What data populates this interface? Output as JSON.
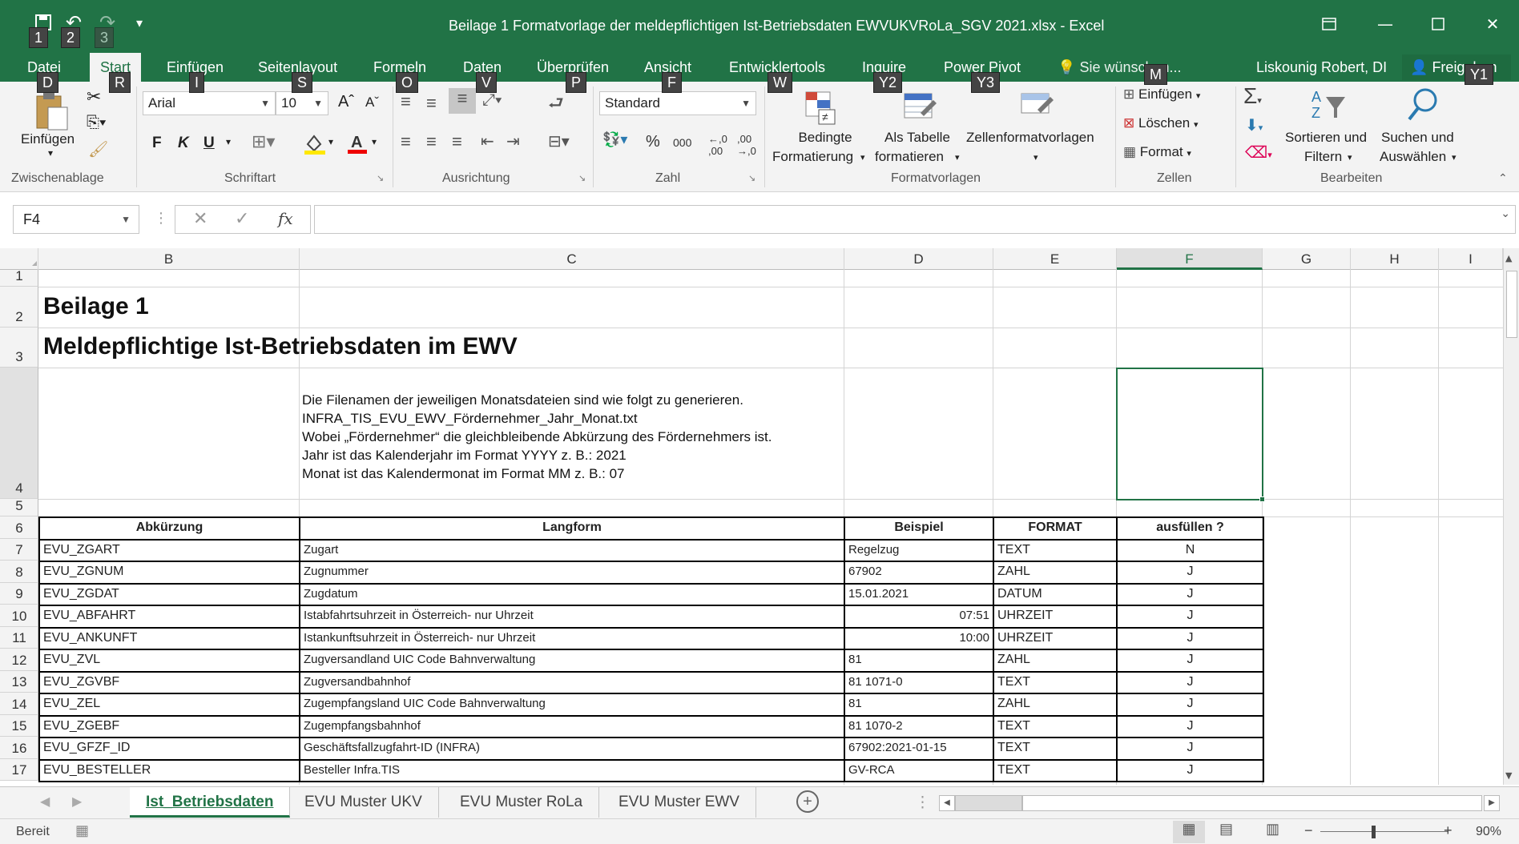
{
  "window": {
    "title": "Beilage 1 Formatvorlage der meldepflichtigen Ist-Betriebsdaten EWVUKVRoLa_SGV 2021.xlsx - Excel",
    "keytips_qat": [
      "1",
      "2",
      "3"
    ]
  },
  "menu": {
    "tabs": [
      {
        "label": "Datei",
        "keytip": "D"
      },
      {
        "label": "Start",
        "keytip": "R"
      },
      {
        "label": "Einfügen",
        "keytip": "I"
      },
      {
        "label": "Seitenlayout",
        "keytip": "S"
      },
      {
        "label": "Formeln",
        "keytip": "O"
      },
      {
        "label": "Daten",
        "keytip": "V"
      },
      {
        "label": "Überprüfen",
        "keytip": "P"
      },
      {
        "label": "Ansicht",
        "keytip": "F"
      },
      {
        "label": "Entwicklertools",
        "keytip": "W"
      },
      {
        "label": "Inquire",
        "keytip": "Y2"
      },
      {
        "label": "Power Pivot",
        "keytip": "Y3"
      }
    ],
    "tell_me": "Sie wünschen...",
    "tell_me_keytip": "M",
    "user": "Liskounig Robert, DI",
    "share": "Freigeben",
    "share_keytip": "Y1"
  },
  "ribbon": {
    "clipboard": {
      "paste": "Einfügen",
      "label": "Zwischenablage"
    },
    "font": {
      "name": "Arial",
      "size": "10",
      "bold": "F",
      "italic": "K",
      "underline": "U",
      "label": "Schriftart"
    },
    "alignment": {
      "label": "Ausrichtung"
    },
    "number": {
      "format": "Standard",
      "label": "Zahl"
    },
    "styles": {
      "conditional": "Bedingte Formatierung",
      "conditional_l1": "Bedingte",
      "conditional_l2": "Formatierung",
      "as_table_l1": "Als Tabelle",
      "as_table_l2": "formatieren",
      "cell_styles": "Zellenformatvorlagen",
      "label": "Formatvorlagen"
    },
    "cells": {
      "insert": "Einfügen",
      "delete": "Löschen",
      "format": "Format",
      "label": "Zellen"
    },
    "editing": {
      "sort_l1": "Sortieren und",
      "sort_l2": "Filtern",
      "find_l1": "Suchen und",
      "find_l2": "Auswählen",
      "label": "Bearbeiten"
    }
  },
  "formula_bar": {
    "name_box": "F4",
    "fx": "fx",
    "content": ""
  },
  "columns": [
    "B",
    "C",
    "D",
    "E",
    "F",
    "G",
    "H",
    "I"
  ],
  "rows": [
    "1",
    "2",
    "3",
    "4",
    "5",
    "6",
    "7",
    "8",
    "9",
    "10",
    "11",
    "12",
    "13",
    "14",
    "15",
    "16",
    "17"
  ],
  "sheet": {
    "title1": "Beilage 1",
    "title2": "Meldepflichtige Ist-Betriebsdaten im EWV",
    "notes": [
      "Die Filenamen der jeweiligen Monatsdateien sind wie folgt zu generieren.",
      "INFRA_TIS_EVU_EWV_Fördernehmer_Jahr_Monat.txt",
      "Wobei „Fördernehmer“ die gleichbleibende Abkürzung des Fördernehmers ist.",
      "Jahr ist das Kalenderjahr im Format YYYY z. B.: 2021",
      "Monat ist das Kalendermonat im Format MM z. B.: 07"
    ],
    "table_headers": [
      "Abkürzung",
      "Langform",
      "Beispiel",
      "FORMAT",
      "ausfüllen ?"
    ],
    "table_rows": [
      [
        "EVU_ZGART",
        "Zugart",
        "Regelzug",
        "TEXT",
        "N"
      ],
      [
        "EVU_ZGNUM",
        "Zugnummer",
        "67902",
        "ZAHL",
        "J"
      ],
      [
        "EVU_ZGDAT",
        "Zugdatum",
        "15.01.2021",
        "DATUM",
        "J"
      ],
      [
        "EVU_ABFAHRT",
        "Istabfahrtsuhrzeit in Österreich- nur Uhrzeit",
        "07:51",
        "UHRZEIT",
        "J"
      ],
      [
        "EVU_ANKUNFT",
        "Istankunftsuhrzeit in Österreich- nur Uhrzeit",
        "10:00",
        "UHRZEIT",
        "J"
      ],
      [
        "EVU_ZVL",
        "Zugversandland  UIC Code Bahnverwaltung",
        "81",
        "ZAHL",
        "J"
      ],
      [
        "EVU_ZGVBF",
        "Zugversandbahnhof",
        "81 1071-0",
        "TEXT",
        "J"
      ],
      [
        "EVU_ZEL",
        "Zugempfangsland  UIC Code Bahnverwaltung",
        "81",
        "ZAHL",
        "J"
      ],
      [
        "EVU_ZGEBF",
        "Zugempfangsbahnhof",
        "81 1070-2",
        "TEXT",
        "J"
      ],
      [
        "EVU_GFZF_ID",
        "Geschäftsfallzugfahrt-ID (INFRA)",
        "67902:2021-01-15",
        "TEXT",
        "J"
      ],
      [
        "EVU_BESTELLER",
        "Besteller Infra.TIS",
        "GV-RCA",
        "TEXT",
        "J"
      ]
    ],
    "right_aligned_examples": [
      3,
      4
    ]
  },
  "sheet_tabs": [
    "Ist_Betriebsdaten",
    "EVU Muster UKV",
    "EVU Muster RoLa",
    "EVU Muster EWV"
  ],
  "status": {
    "ready": "Bereit",
    "zoom": "90%"
  },
  "colors": {
    "accent": "#217346",
    "ribbon_bg": "#f3f3f3",
    "header_bg": "#f3f3f3"
  }
}
